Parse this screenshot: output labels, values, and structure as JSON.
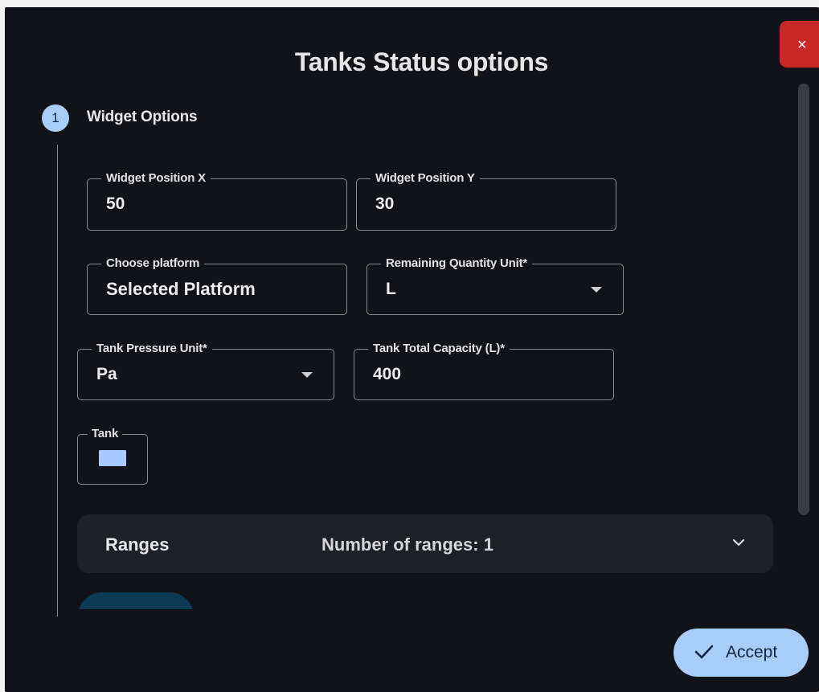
{
  "dialog": {
    "title": "Tanks Status options",
    "close_label": "×"
  },
  "step": {
    "number": "1",
    "label": "Widget Options"
  },
  "fields": {
    "position_x": {
      "label": "Widget Position X",
      "value": "50"
    },
    "position_y": {
      "label": "Widget Position Y",
      "value": "30"
    },
    "platform": {
      "label": "Choose platform",
      "value": "Selected Platform"
    },
    "quantity_unit": {
      "label": "Remaining Quantity Unit*",
      "value": "L"
    },
    "pressure_unit": {
      "label": "Tank Pressure Unit*",
      "value": "Pa"
    },
    "capacity": {
      "label": "Tank Total Capacity (L)*",
      "value": "400"
    },
    "tank_color": {
      "label": "Tank",
      "color": "#a6c8ff"
    }
  },
  "ranges": {
    "title": "Ranges",
    "count_text": "Number of ranges: 1"
  },
  "footer": {
    "accept_label": "Accept"
  },
  "colors": {
    "dialog_bg": "#111318",
    "accent": "#a8cdf8",
    "close": "#c62828"
  }
}
